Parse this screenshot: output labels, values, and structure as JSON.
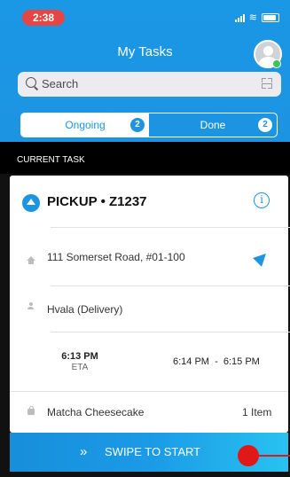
{
  "status": {
    "time": "2:38"
  },
  "header": {
    "title": "My Tasks"
  },
  "search": {
    "placeholder": "Search"
  },
  "tabs": [
    {
      "label": "Ongoing",
      "count": "2"
    },
    {
      "label": "Done",
      "count": "2"
    }
  ],
  "section": {
    "label": "CURRENT TASK"
  },
  "task": {
    "title": "PICKUP • Z1237",
    "address": "111 Somerset Road, #01-100",
    "recipient": "Hvala (Delivery)",
    "eta_time": "6:13 PM",
    "eta_label": "ETA",
    "window": "6:14 PM  -  6:15 PM",
    "item_name": "Matcha Cheesecake",
    "item_count": "1 Item"
  },
  "swipe": {
    "chevron": "»",
    "label": "SWIPE TO START"
  },
  "colors": {
    "accent": "#1d94e2",
    "status_red": "#e64545",
    "slider": "#e01818",
    "online": "#3bc45a"
  }
}
